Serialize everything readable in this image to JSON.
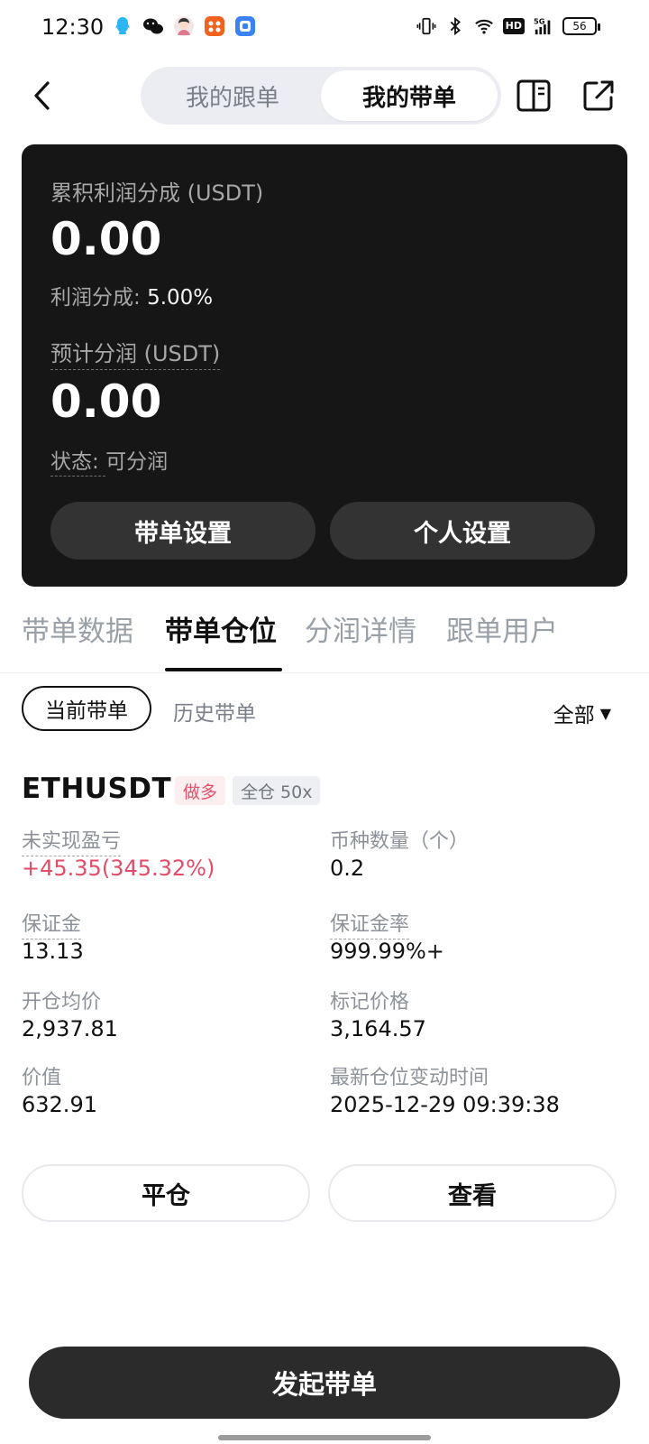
{
  "status_bar": {
    "time": "12:30",
    "hd": "HD",
    "network": "5G",
    "battery": "56"
  },
  "header": {
    "tab_following": "我的跟单",
    "tab_leading": "我的带单",
    "selected": "我的带单"
  },
  "summary": {
    "cumulative_label": "累积利润分成 (USDT)",
    "cumulative_value": "0.00",
    "share_label": "利润分成: ",
    "share_value": "5.00%",
    "estimated_label": "预计分润 (USDT)",
    "estimated_value": "0.00",
    "status_label": "状态: ",
    "status_value": "可分润",
    "btn_lead_settings": "带单设置",
    "btn_personal_settings": "个人设置"
  },
  "tabs": {
    "items": [
      "带单数据",
      "带单仓位",
      "分润详情",
      "跟单用户"
    ],
    "active": "带单仓位"
  },
  "filters": {
    "current": "当前带单",
    "history": "历史带单",
    "all": "全部"
  },
  "position": {
    "symbol": "ETHUSDT",
    "side_tag": "做多",
    "margin_tag": "全仓 50x",
    "pnl_label": "未实现盈亏",
    "pnl_value": "+45.35(345.32%)",
    "qty_label": "币种数量（个）",
    "qty_value": "0.2",
    "margin_label": "保证金",
    "margin_value": "13.13",
    "margin_ratio_label": "保证金率",
    "margin_ratio_value": "999.99%+",
    "entry_label": "开仓均价",
    "entry_value": "2,937.81",
    "mark_label": "标记价格",
    "mark_value": "3,164.57",
    "value_label": "价值",
    "value_value": "632.91",
    "updated_label": "最新仓位变动时间",
    "updated_value": "2025-12-29 09:39:38",
    "btn_close": "平仓",
    "btn_view": "查看"
  },
  "cta": {
    "label": "发起带单"
  },
  "colors": {
    "card_bg": "#161616",
    "profit_red": "#e34c68",
    "tag_red_bg": "#fdeef0",
    "cta_bg": "#2b2b2b"
  }
}
